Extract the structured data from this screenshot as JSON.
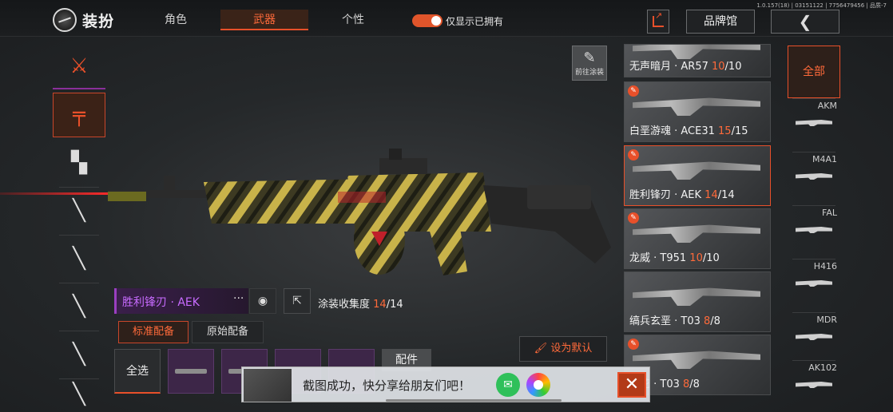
{
  "header": {
    "title": "装扮",
    "tabs": [
      {
        "label": "角色",
        "active": false
      },
      {
        "label": "武器",
        "active": true
      },
      {
        "label": "个性",
        "active": false
      }
    ],
    "toggle_label": "仅显示已拥有",
    "toggle_on": true,
    "version": "1.0.157(18) | 03151122 | 7756479456 | 品质-7",
    "brand_label": "品牌馆",
    "back_label": "❮"
  },
  "left_categories": [
    {
      "name": "all-category",
      "icon": "⚔"
    },
    {
      "name": "rifle-category",
      "icon": "╤"
    },
    {
      "name": "smg-category",
      "icon": "▚"
    },
    {
      "name": "sniper-category",
      "icon": "╲"
    },
    {
      "name": "shotgun-category",
      "icon": "╲"
    },
    {
      "name": "lmg-category",
      "icon": "╲"
    },
    {
      "name": "pistol-category",
      "icon": "╲"
    },
    {
      "name": "melee-category",
      "icon": "╲"
    }
  ],
  "goto_coating": "前往涂装",
  "current_skin": {
    "name": "胜利锋刃 · AEK",
    "collection_label": "涂装收集度",
    "collected": "14",
    "total": "/14"
  },
  "loadout_tabs": [
    {
      "label": "标准配备",
      "active": true
    },
    {
      "label": "原始配备",
      "active": false
    }
  ],
  "select_all": "全选",
  "parts_label": "配件",
  "set_default": "设为默认",
  "toast": {
    "text": "截图成功，快分享给朋友们吧！",
    "close": "✕"
  },
  "skins": [
    {
      "name": "无声暗月 · AR57 ",
      "owned": "10",
      "total": "/10",
      "active": false
    },
    {
      "name": "白垩游魂 · ACE31 ",
      "owned": "15",
      "total": "/15",
      "active": false
    },
    {
      "name": "胜利锋刃 · AEK ",
      "owned": "14",
      "total": "/14",
      "active": true
    },
    {
      "name": "龙威 · T951 ",
      "owned": "10",
      "total": "/10",
      "active": false
    },
    {
      "name": "缟兵玄垩 · T03 ",
      "owned": "8",
      "total": "/8",
      "active": false
    },
    {
      "name": "梨花 · T03 ",
      "owned": "8",
      "total": "/8",
      "active": false
    }
  ],
  "weapon_types": {
    "all_label": "全部",
    "items": [
      "AKM",
      "M4A1",
      "FAL",
      "H416",
      "MDR",
      "AK102"
    ]
  },
  "colors": {
    "accent": "#e8502a",
    "rare_purple": "#c86bff"
  }
}
